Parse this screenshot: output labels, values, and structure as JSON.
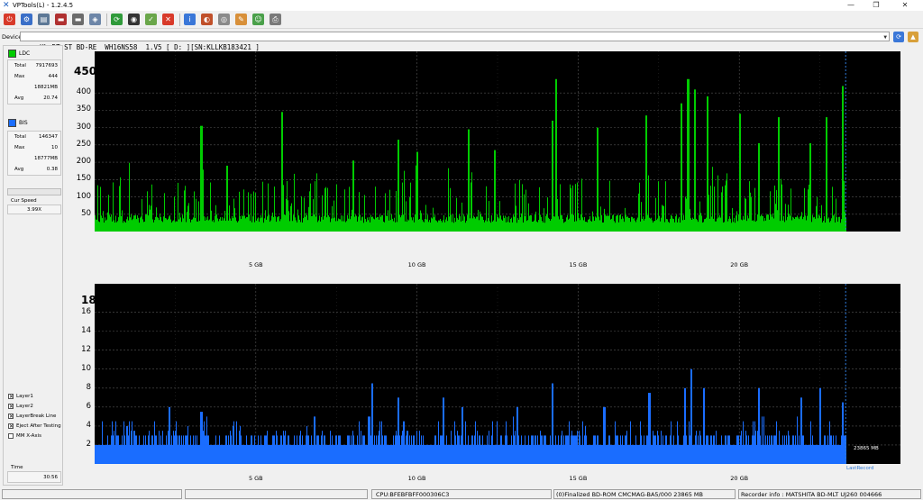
{
  "window": {
    "title": "VPTools(L) - 1.2.4.5"
  },
  "toolbar": {
    "buttons": [
      {
        "name": "power-icon",
        "color": "#d83a2a",
        "glyph": "⏻"
      },
      {
        "name": "settings-icon",
        "color": "#3a6fc8",
        "glyph": "⚙"
      },
      {
        "name": "monitor-icon",
        "color": "#5d7896",
        "glyph": "▤"
      },
      {
        "name": "disc-drive-icon",
        "color": "#b03030",
        "glyph": "▬"
      },
      {
        "name": "drive-icon",
        "color": "#6b6b6b",
        "glyph": "▬"
      },
      {
        "name": "scan-icon",
        "color": "#6d86a8",
        "glyph": "◈"
      },
      {
        "name": "refresh-icon",
        "color": "#2f9a3a",
        "glyph": "⟳"
      },
      {
        "name": "disc-icon",
        "color": "#333333",
        "glyph": "◉"
      },
      {
        "name": "check-icon",
        "color": "#6aa64a",
        "glyph": "✓"
      },
      {
        "name": "stop-icon",
        "color": "#d83a2a",
        "glyph": "✕"
      },
      {
        "name": "info-icon",
        "color": "#3a77d8",
        "glyph": "i"
      },
      {
        "name": "burn-icon",
        "color": "#c0502a",
        "glyph": "◐"
      },
      {
        "name": "media-icon",
        "color": "#8a8a8a",
        "glyph": "◎"
      },
      {
        "name": "paint-icon",
        "color": "#d8903a",
        "glyph": "✎"
      },
      {
        "name": "user-icon",
        "color": "#4aa04a",
        "glyph": "☺"
      },
      {
        "name": "printer-icon",
        "color": "#7a7a7a",
        "glyph": "⎙"
      }
    ]
  },
  "device": {
    "label": "Device:",
    "value": "HL-DT-ST BD-RE  WH16NS58  1.V5 [ D: ][SN:KLLKB183421 ]"
  },
  "colors": {
    "ldc": "#00cc00",
    "bis": "#1a6dff",
    "background": "#000000",
    "grid": "#555555"
  },
  "ldc": {
    "title": "LDC",
    "total_label": "Total",
    "total": "7917693",
    "max_label": "Max",
    "max": "444",
    "size": "18821MB",
    "avg_label": "Avg",
    "avg": "20.74"
  },
  "bis": {
    "title": "BIS",
    "total_label": "Total",
    "total": "146347",
    "max_label": "Max",
    "max": "10",
    "size": "18777MB",
    "avg_label": "Avg",
    "avg": "0.38"
  },
  "speed": {
    "label": "Cur Speed",
    "value": "3.99X"
  },
  "options": [
    {
      "label": "Layer1",
      "checked": true
    },
    {
      "label": "Layer2",
      "checked": true
    },
    {
      "label": "LayerBreak Line",
      "checked": true
    },
    {
      "label": "Eject After Testing",
      "checked": true
    },
    {
      "label": "MM X-Axis",
      "checked": false
    }
  ],
  "time": {
    "label": "Time",
    "value": "30:56"
  },
  "chart_data": [
    {
      "type": "area",
      "series": [
        {
          "name": "LDC"
        }
      ],
      "max_label": "450",
      "x_ticks": [
        "5 GB",
        "10 GB",
        "15 GB",
        "20 GB"
      ],
      "x_tick_values": [
        5,
        10,
        15,
        20
      ],
      "xlim": [
        0,
        25
      ],
      "y_ticks": [
        50,
        100,
        150,
        200,
        250,
        300,
        350,
        400
      ],
      "ylim": [
        0,
        520
      ],
      "data_end_gb": 23.3,
      "baseline": 25,
      "peaks": [
        [
          3.3,
          305
        ],
        [
          4.1,
          190
        ],
        [
          5.8,
          345
        ],
        [
          8.0,
          205
        ],
        [
          9.4,
          265
        ],
        [
          10.0,
          230
        ],
        [
          11.6,
          295
        ],
        [
          12.4,
          235
        ],
        [
          14.2,
          320
        ],
        [
          14.3,
          440
        ],
        [
          15.6,
          300
        ],
        [
          17.1,
          335
        ],
        [
          18.2,
          370
        ],
        [
          18.4,
          440
        ],
        [
          18.6,
          410
        ],
        [
          19.0,
          390
        ],
        [
          20.0,
          340
        ],
        [
          20.6,
          255
        ],
        [
          21.2,
          330
        ],
        [
          22.2,
          255
        ],
        [
          22.7,
          330
        ],
        [
          23.2,
          420
        ]
      ],
      "grid": true
    },
    {
      "type": "bar",
      "series": [
        {
          "name": "BIS"
        }
      ],
      "max_label": "18",
      "x_ticks": [
        "5 GB",
        "10 GB",
        "15 GB",
        "20 GB"
      ],
      "x_tick_values": [
        5,
        10,
        15,
        20
      ],
      "xlim": [
        0,
        25
      ],
      "y_ticks": [
        2,
        4,
        6,
        8,
        10,
        12,
        14,
        16
      ],
      "ylim": [
        0,
        19
      ],
      "data_end_gb": 23.3,
      "baseline": 2,
      "peaks": [
        [
          1.0,
          4
        ],
        [
          2.3,
          6
        ],
        [
          3.3,
          5.5
        ],
        [
          4.3,
          4
        ],
        [
          6.8,
          5
        ],
        [
          8.5,
          5
        ],
        [
          8.6,
          8.5
        ],
        [
          9.4,
          7
        ],
        [
          10.8,
          7
        ],
        [
          11.4,
          6
        ],
        [
          13.1,
          6
        ],
        [
          14.2,
          8.5
        ],
        [
          15.8,
          6
        ],
        [
          17.2,
          7.5
        ],
        [
          18.3,
          8
        ],
        [
          18.5,
          10
        ],
        [
          18.9,
          8
        ],
        [
          20.6,
          8
        ],
        [
          21.9,
          7
        ],
        [
          22.5,
          8
        ],
        [
          23.2,
          6.5
        ]
      ],
      "grid": true,
      "annotation": "23865 MB",
      "last_record_label": "LastRecord"
    }
  ],
  "status": {
    "cell1": "",
    "cell2": "",
    "cpu": "CPU:BFEBFBFF000306C3",
    "disc": "(0)Finalized  BD-ROM  CMCMAG-BA5/000  23865 MB",
    "recorder": "Recorder info  : MATSHITA     BD-MLT UJ260     004666"
  }
}
